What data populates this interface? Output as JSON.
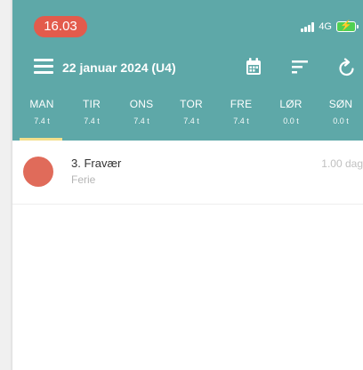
{
  "status_bar": {
    "time": "16.03",
    "network": "4G",
    "battery_color": "#50d052"
  },
  "app_bar": {
    "title": "22 januar 2024 (U4)",
    "menu_icon": "hamburger-menu-icon",
    "calendar_icon": "calendar-icon",
    "sort_icon": "sort-icon",
    "refresh_icon": "refresh-icon"
  },
  "week": {
    "active_index": 0,
    "days": [
      {
        "name": "MAN",
        "hours": "7.4 t"
      },
      {
        "name": "TIR",
        "hours": "7.4 t"
      },
      {
        "name": "ONS",
        "hours": "7.4 t"
      },
      {
        "name": "TOR",
        "hours": "7.4 t"
      },
      {
        "name": "FRE",
        "hours": "7.4 t"
      },
      {
        "name": "LØR",
        "hours": "0.0 t"
      },
      {
        "name": "SØN",
        "hours": "0.0 t"
      }
    ]
  },
  "entries": [
    {
      "title": "3. Fravær",
      "subtitle": "Ferie",
      "duration": "1.00 dag",
      "color": "#e06b5a"
    }
  ],
  "colors": {
    "header": "#5ea8a8",
    "accent": "#f3df8c",
    "time_pill": "#e35b4c"
  }
}
